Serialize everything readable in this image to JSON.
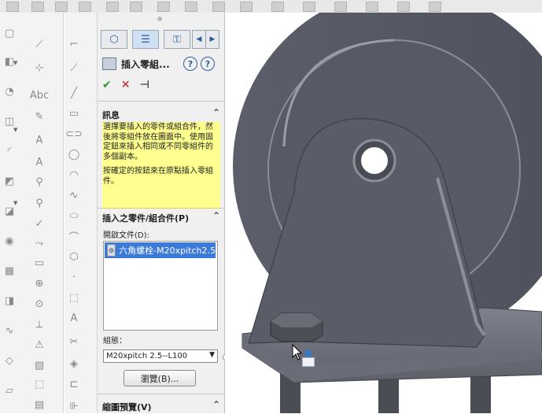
{
  "toolbar": {
    "icons": [
      "toolbar-icon"
    ]
  },
  "panel": {
    "tabs": [
      {
        "name": "feature-manager-tab",
        "glyph": "⬡"
      },
      {
        "name": "property-manager-tab",
        "glyph": "☰"
      },
      {
        "name": "configuration-manager-tab",
        "glyph": "⚿"
      }
    ],
    "title": "插入零組...",
    "message_header": "訊息",
    "message_p1": "選擇要插入的零件或組合件，然後將零組件放在圖面中。使用固定鈕來插入相同或不同零組件的多個副本。",
    "message_p2": "按確定的按鈕來在原點插入零組件。",
    "insert_header": "插入之零件/組合件(P)",
    "open_docs_label": "開啟文件(D):",
    "open_doc_item": "六角螺栓-M20xpitch2.5",
    "config_label": "組態：",
    "config_value": "M20xpitch 2.5--L100",
    "browse_label": "瀏覽(B)...",
    "preview_header": "縮圖預覽(V)"
  }
}
